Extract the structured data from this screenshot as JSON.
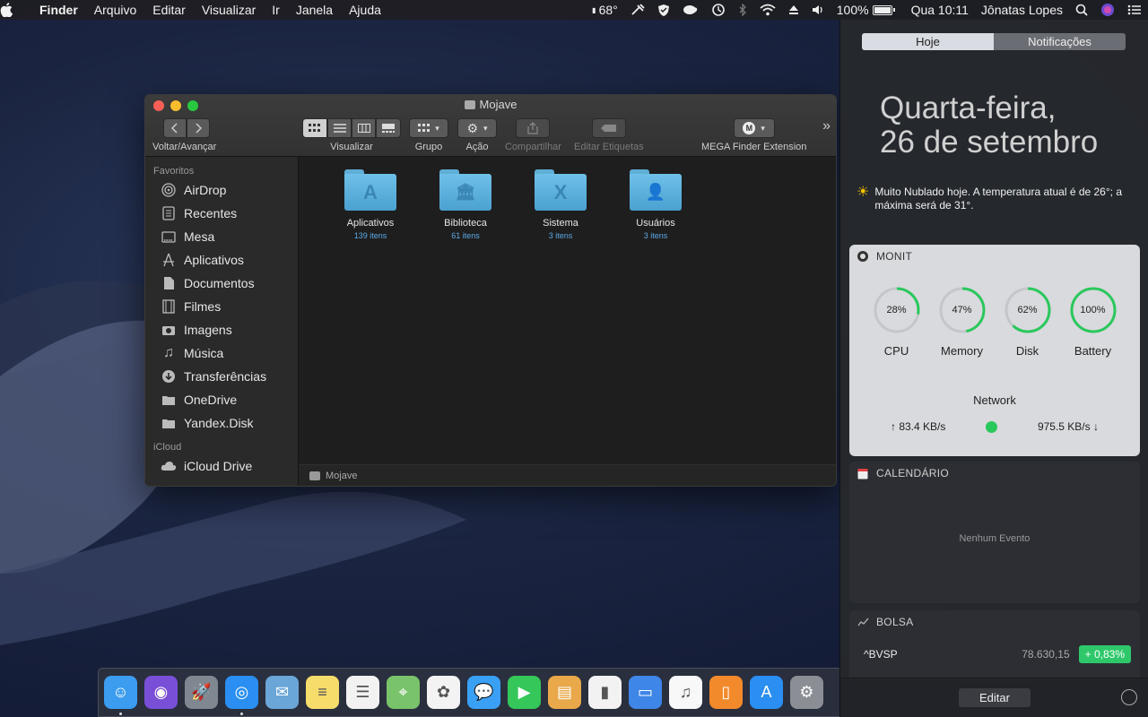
{
  "menubar": {
    "app": "Finder",
    "menus": [
      "Arquivo",
      "Editar",
      "Visualizar",
      "Ir",
      "Janela",
      "Ajuda"
    ],
    "temperature": "68°",
    "battery": "100%",
    "clock": "Qua 10:11",
    "user": "Jônatas Lopes"
  },
  "finder": {
    "title": "Mojave",
    "toolbar": {
      "nav_label": "Voltar/Avançar",
      "view_label": "Visualizar",
      "group_label": "Grupo",
      "action_label": "Ação",
      "share_label": "Compartilhar",
      "tags_label": "Editar Etiquetas",
      "mega_label": "MEGA Finder Extension",
      "more_icon": "»"
    },
    "sidebar": {
      "favorites_header": "Favoritos",
      "favorites": [
        {
          "label": "AirDrop",
          "icon": "airdrop-icon"
        },
        {
          "label": "Recentes",
          "icon": "recents-icon"
        },
        {
          "label": "Mesa",
          "icon": "desktop-icon"
        },
        {
          "label": "Aplicativos",
          "icon": "applications-icon"
        },
        {
          "label": "Documentos",
          "icon": "documents-icon"
        },
        {
          "label": "Filmes",
          "icon": "movies-icon"
        },
        {
          "label": "Imagens",
          "icon": "pictures-icon"
        },
        {
          "label": "Música",
          "icon": "music-icon"
        },
        {
          "label": "Transferências",
          "icon": "downloads-icon"
        },
        {
          "label": "OneDrive",
          "icon": "folder-icon"
        },
        {
          "label": "Yandex.Disk",
          "icon": "folder-icon"
        }
      ],
      "icloud_header": "iCloud",
      "icloud": [
        {
          "label": "iCloud Drive",
          "icon": "cloud-icon"
        }
      ]
    },
    "items": [
      {
        "name": "Aplicativos",
        "count": "139 itens",
        "glyph": "A"
      },
      {
        "name": "Biblioteca",
        "count": "61 itens",
        "glyph": "🏛"
      },
      {
        "name": "Sistema",
        "count": "3 itens",
        "glyph": "X"
      },
      {
        "name": "Usuários",
        "count": "3 itens",
        "glyph": "👤"
      }
    ],
    "path": "Mojave"
  },
  "notification_center": {
    "tabs": {
      "today": "Hoje",
      "notifications": "Notificações"
    },
    "date_line1": "Quarta-feira,",
    "date_line2": "26 de setembro",
    "weather": "Muito Nublado hoje. A temperatura atual é de 26°; a máxima será de 31°.",
    "monit": {
      "title": "MONIT",
      "gauges": [
        {
          "label": "CPU",
          "value": "28%",
          "pct": 28
        },
        {
          "label": "Memory",
          "value": "47%",
          "pct": 47
        },
        {
          "label": "Disk",
          "value": "62%",
          "pct": 62
        },
        {
          "label": "Battery",
          "value": "100%",
          "pct": 100
        }
      ],
      "network_title": "Network",
      "upload": "↑ 83.4 KB/s",
      "download": "975.5 KB/s ↓",
      "accent": "#2ac85c"
    },
    "calendar": {
      "title": "CALENDÁRIO",
      "empty": "Nenhum Evento"
    },
    "bolsa": {
      "title": "BOLSA",
      "stocks": [
        {
          "symbol": "^BVSP",
          "price": "78.630,15",
          "change": "+ 0,83%"
        }
      ]
    },
    "edit_label": "Editar"
  },
  "dock": {
    "apps": [
      {
        "name": "finder-icon",
        "color": "#3b9cf0",
        "glyph": "☺",
        "running": true
      },
      {
        "name": "siri-icon",
        "color": "#7a4fd8",
        "glyph": "◉",
        "running": false
      },
      {
        "name": "launchpad-icon",
        "color": "#7f8790",
        "glyph": "🚀",
        "running": false
      },
      {
        "name": "safari-icon",
        "color": "#2a8ef2",
        "glyph": "◎",
        "running": true
      },
      {
        "name": "mail-icon",
        "color": "#6aa6d8",
        "glyph": "✉",
        "running": false
      },
      {
        "name": "notes-icon",
        "color": "#f6dd6b",
        "glyph": "≡",
        "running": false
      },
      {
        "name": "reminders-icon",
        "color": "#f2f2f2",
        "glyph": "☰",
        "running": false
      },
      {
        "name": "maps-icon",
        "color": "#79c36a",
        "glyph": "⌖",
        "running": false
      },
      {
        "name": "photos-icon",
        "color": "#f3f3f3",
        "glyph": "✿",
        "running": false
      },
      {
        "name": "messages-icon",
        "color": "#3aa0f5",
        "glyph": "💬",
        "running": false
      },
      {
        "name": "facetime-icon",
        "color": "#35c759",
        "glyph": "▶",
        "running": false
      },
      {
        "name": "preview-icon",
        "color": "#e9a84a",
        "glyph": "▤",
        "running": false
      },
      {
        "name": "numbers-icon",
        "color": "#f2f2f2",
        "glyph": "▮",
        "running": false
      },
      {
        "name": "keynote-icon",
        "color": "#3e86e8",
        "glyph": "▭",
        "running": false
      },
      {
        "name": "itunes-icon",
        "color": "#f8f8f8",
        "glyph": "♫",
        "running": false
      },
      {
        "name": "books-icon",
        "color": "#f28a2c",
        "glyph": "▯",
        "running": false
      },
      {
        "name": "app-store-icon",
        "color": "#2a8ef2",
        "glyph": "A",
        "running": false
      },
      {
        "name": "system-preferences-icon",
        "color": "#8b8f95",
        "glyph": "⚙",
        "running": false
      }
    ]
  }
}
